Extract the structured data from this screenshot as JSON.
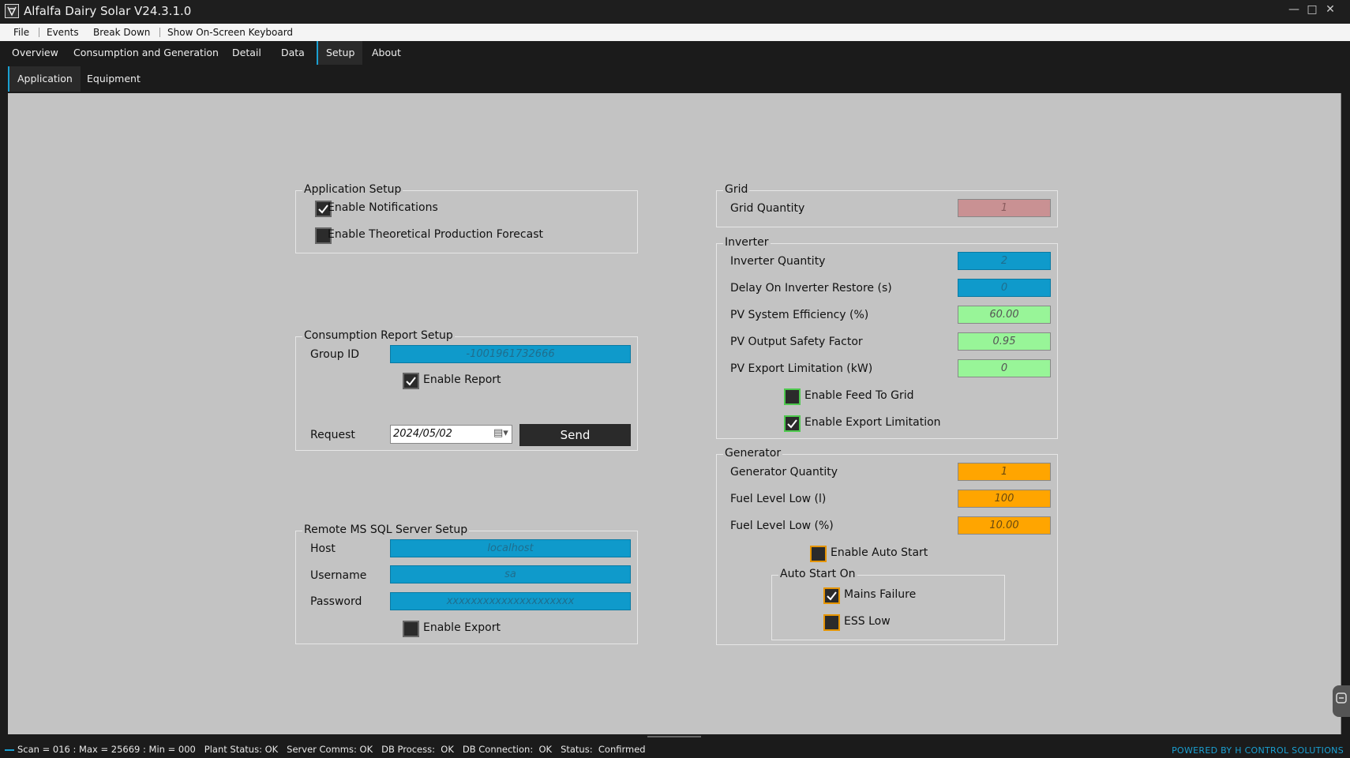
{
  "window": {
    "title": "Alfalfa Dairy Solar V24.3.1.0"
  },
  "menu": [
    "File",
    "Events",
    "Break Down",
    "Show On-Screen Keyboard"
  ],
  "main_tabs": [
    "Overview",
    "Consumption and Generation",
    "Detail",
    "Data",
    "Setup",
    "About"
  ],
  "active_main_tab": "Setup",
  "sub_tabs": [
    "Application",
    "Equipment"
  ],
  "active_sub_tab": "Application",
  "application_setup": {
    "title": "Application Setup",
    "enable_notifications": {
      "label": "Enable Notifications",
      "checked": true
    },
    "enable_forecast": {
      "label": "Enable Theoretical Production Forecast",
      "checked": false
    }
  },
  "consumption_report": {
    "title": "Consumption Report Setup",
    "group_id_label": "Group ID",
    "group_id_value": "-1001961732666",
    "enable_report": {
      "label": "Enable Report",
      "checked": true
    },
    "request_label": "Request",
    "request_date": "2024/05/02",
    "send_label": "Send"
  },
  "sql_server": {
    "title": "Remote MS SQL Server Setup",
    "host_label": "Host",
    "host_value": "localhost",
    "username_label": "Username",
    "username_value": "sa",
    "password_label": "Password",
    "password_value": "xxxxxxxxxxxxxxxxxxxxx",
    "enable_export": {
      "label": "Enable Export",
      "checked": false
    }
  },
  "grid": {
    "title": "Grid",
    "quantity_label": "Grid Quantity",
    "quantity_value": "1"
  },
  "inverter": {
    "title": "Inverter",
    "quantity_label": "Inverter Quantity",
    "quantity_value": "2",
    "delay_label": "Delay On Inverter Restore (s)",
    "delay_value": "0",
    "efficiency_label": "PV System Efficiency (%)",
    "efficiency_value": "60.00",
    "safety_label": "PV Output Safety Factor",
    "safety_value": "0.95",
    "export_limit_label": "PV Export Limitation (kW)",
    "export_limit_value": "0",
    "feed_to_grid": {
      "label": "Enable Feed To Grid",
      "checked": false
    },
    "export_limitation": {
      "label": "Enable Export Limitation",
      "checked": true
    }
  },
  "generator": {
    "title": "Generator",
    "quantity_label": "Generator Quantity",
    "quantity_value": "1",
    "fuel_low_l_label": "Fuel Level Low (l)",
    "fuel_low_l_value": "100",
    "fuel_low_pct_label": "Fuel Level Low (%)",
    "fuel_low_pct_value": "10.00",
    "auto_start": {
      "label": "Enable Auto Start",
      "checked": false
    },
    "auto_start_on": {
      "title": "Auto Start On",
      "mains_failure": {
        "label": "Mains Failure",
        "checked": true
      },
      "ess_low": {
        "label": "ESS Low",
        "checked": false
      }
    }
  },
  "status": {
    "text": "Scan = 016 : Max = 25669 : Min = 000   Plant Status: OK   Server Comms: OK   DB Process:  OK   DB Connection:  OK   Status:  Confirmed",
    "powered": "POWERED BY H CONTROL SOLUTIONS"
  },
  "colors": {
    "accent": "#1aa0d2",
    "field_blue": "#0f9acb",
    "field_green": "#98f598",
    "field_orange": "#ffa500",
    "field_rose": "#c99193",
    "content_bg": "#c3c3c3"
  }
}
